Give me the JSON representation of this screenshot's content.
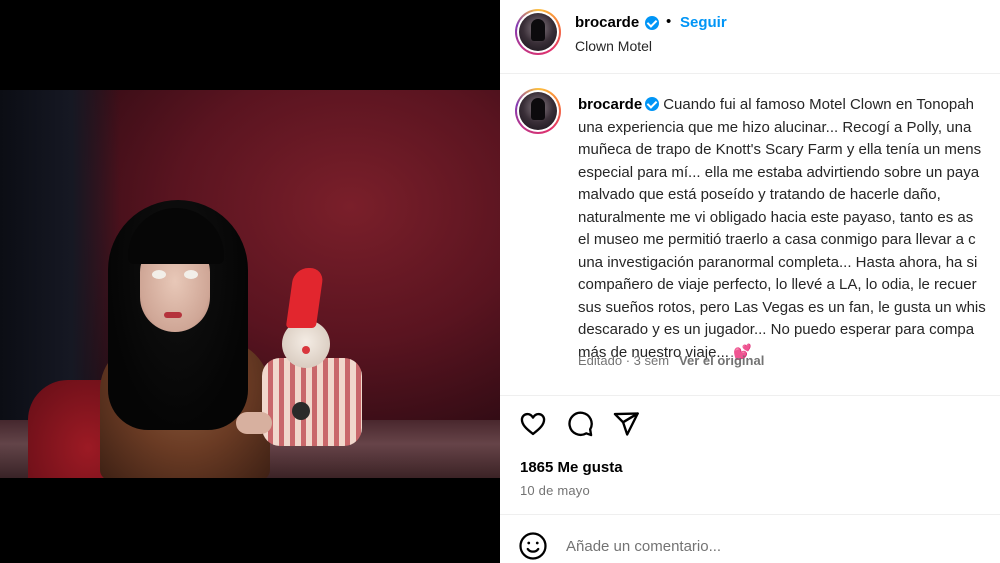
{
  "post": {
    "username": "brocarde",
    "verified": true,
    "separator": "•",
    "follow_label": "Seguir",
    "location": "Clown Motel"
  },
  "caption": {
    "username": "brocarde",
    "lines": [
      "Cuando fui al famoso Motel Clown en Tonopah",
      "una experiencia que me hizo alucinar... Recogí a Polly, una",
      "muñeca de trapo de Knott's Scary Farm y ella tenía un mens",
      "especial para mí... ella me estaba advirtiendo sobre un paya",
      "malvado que está poseído y tratando de hacerle daño,",
      "naturalmente me vi obligado hacia este payaso, tanto es as",
      "el museo me permitió traerlo a casa conmigo para llevar a c",
      "una investigación paranormal completa... Hasta ahora, ha si",
      "compañero de viaje perfecto, lo llevé a LA, lo odia, le recuer",
      "sus sueños rotos, pero Las Vegas es un fan, le gusta un whis",
      "descarado y es un jugador... No puedo esperar para compa",
      "más de nuestro viaje... 💕"
    ],
    "edited_label": "Editado · 3 sem",
    "see_original": "Ver el original"
  },
  "actions": {
    "like_icon": "heart-icon",
    "comment_icon": "comment-icon",
    "share_icon": "send-icon"
  },
  "stats": {
    "likes": "1865 Me gusta",
    "date": "10 de mayo"
  },
  "comment": {
    "emoji_icon": "emoji-icon",
    "placeholder": "Añade un comentario..."
  },
  "colors": {
    "accent": "#0095f6",
    "muted": "#737373",
    "border": "#efefef",
    "heart_emoji": "#e6467a"
  }
}
